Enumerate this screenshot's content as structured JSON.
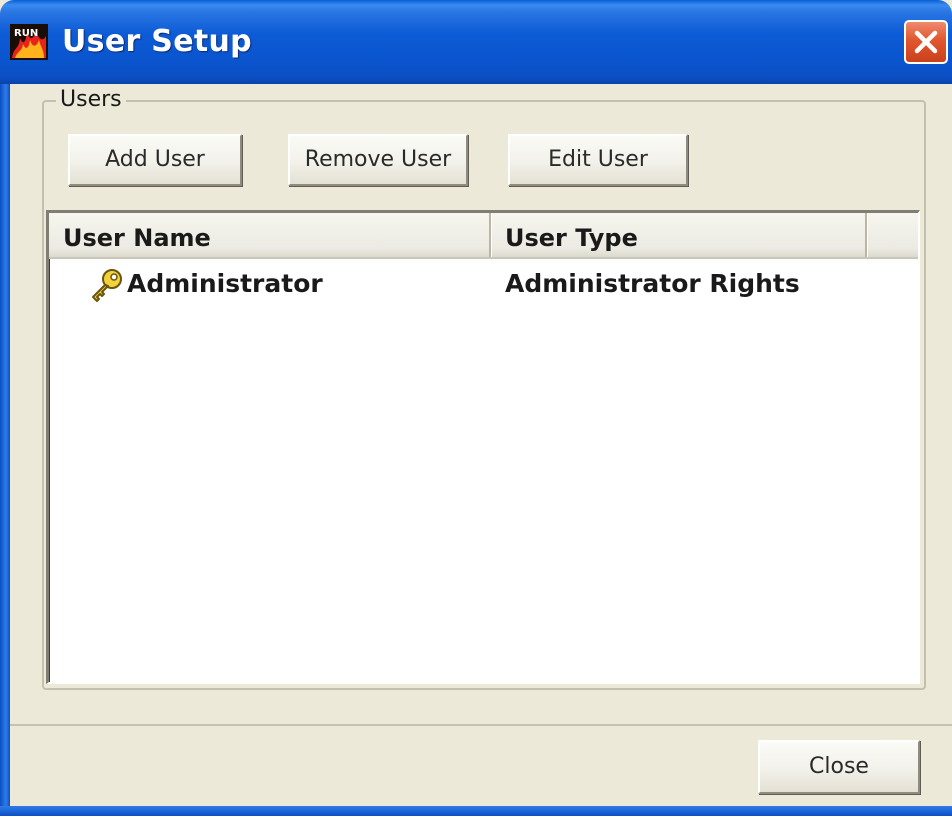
{
  "window": {
    "title": "User Setup",
    "icon": "app-fire-icon",
    "close": "close-icon"
  },
  "users_group": {
    "legend": "Users",
    "add_label": "Add User",
    "remove_label": "Remove User",
    "edit_label": "Edit User"
  },
  "list": {
    "columns": [
      "User Name",
      "User Type"
    ],
    "rows": [
      {
        "icon": "key-icon",
        "name": "Administrator",
        "type": "Administrator Rights"
      }
    ]
  },
  "footer": {
    "close_label": "Close"
  },
  "colors": {
    "titlebar": "#0a55cf",
    "face": "#ece9d8",
    "close_button": "#e0572f"
  }
}
